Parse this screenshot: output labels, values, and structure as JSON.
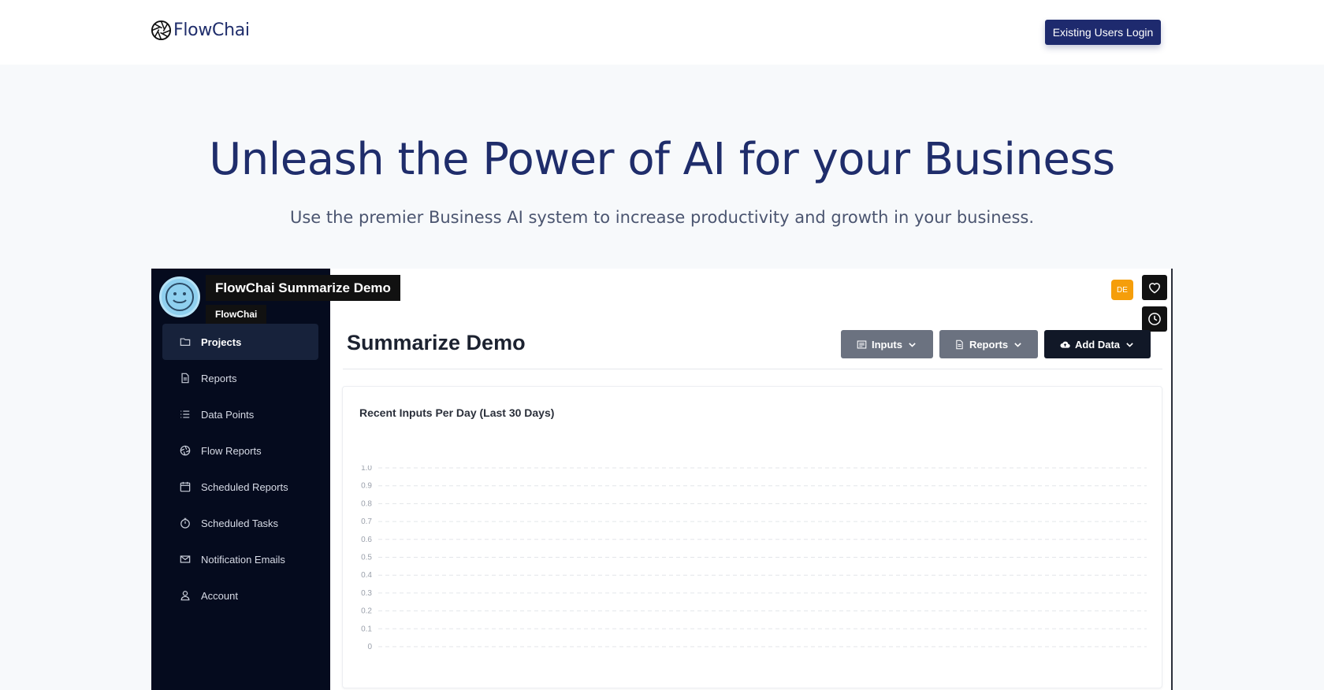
{
  "header": {
    "brand": "FlowChai",
    "login_label": "Existing Users Login"
  },
  "hero": {
    "title": "Unleash the Power of AI for your Business",
    "subtitle": "Use the premier Business AI system to increase productivity and growth in your business."
  },
  "video_overlay": {
    "title": "FlowChai Summarize Demo",
    "channel": "FlowChai",
    "faint_brand": "FlowChai"
  },
  "sidebar": {
    "items": [
      {
        "label": "Projects",
        "icon": "folder-icon",
        "active": true
      },
      {
        "label": "Reports",
        "icon": "document-icon"
      },
      {
        "label": "Data Points",
        "icon": "list-icon"
      },
      {
        "label": "Flow Reports",
        "icon": "aperture-icon"
      },
      {
        "label": "Scheduled Reports",
        "icon": "calendar-icon"
      },
      {
        "label": "Scheduled Tasks",
        "icon": "timer-icon"
      },
      {
        "label": "Notification Emails",
        "icon": "mail-icon"
      },
      {
        "label": "Account",
        "icon": "user-icon"
      }
    ]
  },
  "app": {
    "page_title": "Summarize Demo",
    "user_initials": "DE",
    "buttons": {
      "inputs": "Inputs",
      "reports": "Reports",
      "add_data": "Add Data"
    },
    "card_title": "Recent Inputs Per Day (Last 30 Days)"
  },
  "colors": {
    "brand_navy": "#1e2a6e",
    "sidebar_bg": "#050b1e",
    "badge_orange": "#f59e0b"
  },
  "chart_data": {
    "type": "line",
    "title": "Recent Inputs Per Day (Last 30 Days)",
    "y_ticks": [
      "1.0",
      "0.9",
      "0.8",
      "0.7",
      "0.6",
      "0.5",
      "0.4",
      "0.3",
      "0.2",
      "0.1",
      "0"
    ],
    "ylim": [
      0,
      1
    ],
    "series": [],
    "grid": true
  }
}
